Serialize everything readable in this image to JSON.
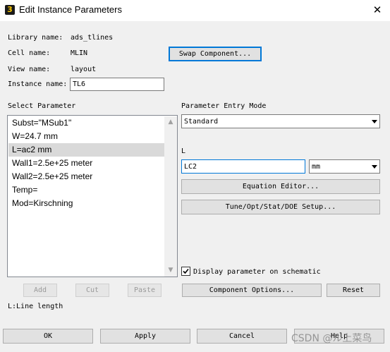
{
  "window": {
    "title": "Edit Instance Parameters",
    "app_icon_glyph": "3",
    "close_glyph": "✕"
  },
  "info": {
    "library_label": "Library name:",
    "library_value": "ads_tlines",
    "cell_label": "Cell name:",
    "cell_value": "MLIN",
    "view_label": "View name:",
    "view_value": "layout",
    "instance_label": "Instance name:",
    "instance_value": "TL6",
    "swap_button": "Swap Component..."
  },
  "parameters": {
    "header": "Select Parameter",
    "items": [
      {
        "label": "Subst=\"MSub1\""
      },
      {
        "label": "W=24.7 mm"
      },
      {
        "label": "L=ac2 mm"
      },
      {
        "label": "Wall1=2.5e+25 meter"
      },
      {
        "label": "Wall2=2.5e+25 meter"
      },
      {
        "label": "Temp="
      },
      {
        "label": "Mod=Kirschning"
      }
    ],
    "selected_index": 2,
    "add_button": "Add",
    "cut_button": "Cut",
    "paste_button": "Paste",
    "description": "L:Line length"
  },
  "entry": {
    "mode_label": "Parameter Entry Mode",
    "mode_value": "Standard",
    "param_label": "L",
    "param_value": "LC2",
    "unit_value": "mm",
    "equation_button": "Equation Editor...",
    "tune_button": "Tune/Opt/Stat/DOE Setup...",
    "display_checkbox_label": "Display parameter on schematic",
    "display_checked": true,
    "component_options_button": "Component Options...",
    "reset_button": "Reset"
  },
  "footer": {
    "ok": "OK",
    "apply": "Apply",
    "cancel": "Cancel",
    "help": "Help"
  },
  "watermark": "CSDN @ル上菜鸟",
  "colors": {
    "accent": "#0078d7",
    "selected_row": "#d9d9d9",
    "window_bg": "#f0f0f0"
  }
}
